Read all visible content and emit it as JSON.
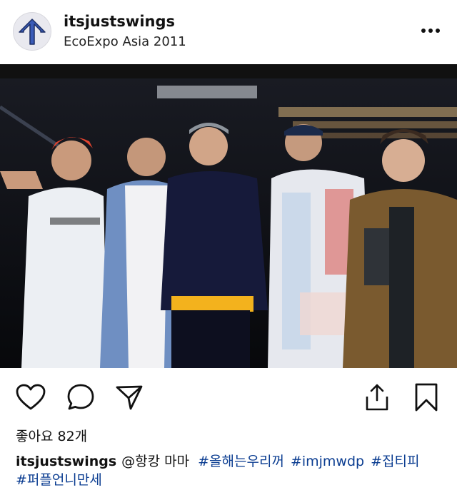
{
  "post": {
    "username": "itsjustswings",
    "location": "EcoExpo Asia 2011"
  },
  "engagement": {
    "likes_text": "좋아요 82개"
  },
  "caption": {
    "username": "itsjustswings",
    "mention": "@항캉 마마",
    "hashtags": [
      "#올해는우리꺼",
      "#imjmwdp",
      "#집티피",
      "#퍼플언니만세"
    ]
  },
  "icons": [
    "arrow-up-icon",
    "more-icon",
    "heart-icon",
    "comment-icon",
    "share-icon",
    "upload-icon",
    "bookmark-icon"
  ],
  "colors": {
    "hashtag": "#0b3d91",
    "avatar_arrow": "#3a5bb8"
  }
}
